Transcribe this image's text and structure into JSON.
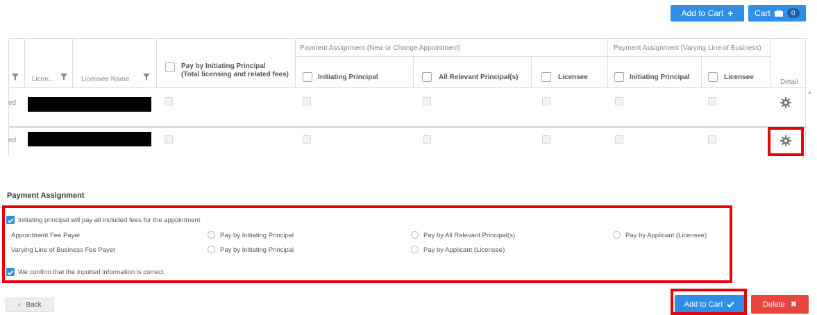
{
  "top": {
    "add_to_cart_label": "Add to Cart",
    "cart_label": "Cart",
    "cart_count": "0"
  },
  "table": {
    "group_new_change": "Payment Assignment (New or Change Appointment)",
    "group_varying": "Payment Assignment (Varying Line of Business)",
    "col_license": "Licen...",
    "col_licensee_name": "Licensee Name",
    "col_pay_initiating_line1": "Pay by Initiating Principal",
    "col_pay_initiating_line2": "(Total licensing and related fees)",
    "col_initiating_principal": "Initiating Principal",
    "col_all_relevant": "All Relevant Principal(s)",
    "col_licensee": "Licensee",
    "col_initiating_principal_2": "Initiating Principal",
    "col_licensee_2": "Licensee",
    "col_detail": "Detail",
    "rows": [
      {
        "status_fragment": "ed"
      },
      {
        "status_fragment": "ed"
      }
    ]
  },
  "payment": {
    "title": "Payment Assignment",
    "initiating_pays_all": "Initiating principal will pay all included fees for the appointment",
    "appointment_fee_payer": "Appointment Fee Payer",
    "appt_opt1": "Pay by Initiating Principal",
    "appt_opt2": "Pay by All Relevant Principal(s)",
    "appt_opt3": "Pay by Applicant (Licensee)",
    "varying_fee_payer": "Varying Line of Business Fee Payer",
    "vary_opt1": "Pay by Initiating Principal",
    "vary_opt2": "Pay by Applicant (Licensee)",
    "confirm": "We confirm that the inputted information is correct."
  },
  "footer": {
    "back_label": "Back",
    "add_to_cart_label": "Add to Cart",
    "delete_label": "Delete"
  },
  "colors": {
    "primary": "#2f8ee5",
    "danger": "#e8453c",
    "highlight": "#e8000b"
  }
}
